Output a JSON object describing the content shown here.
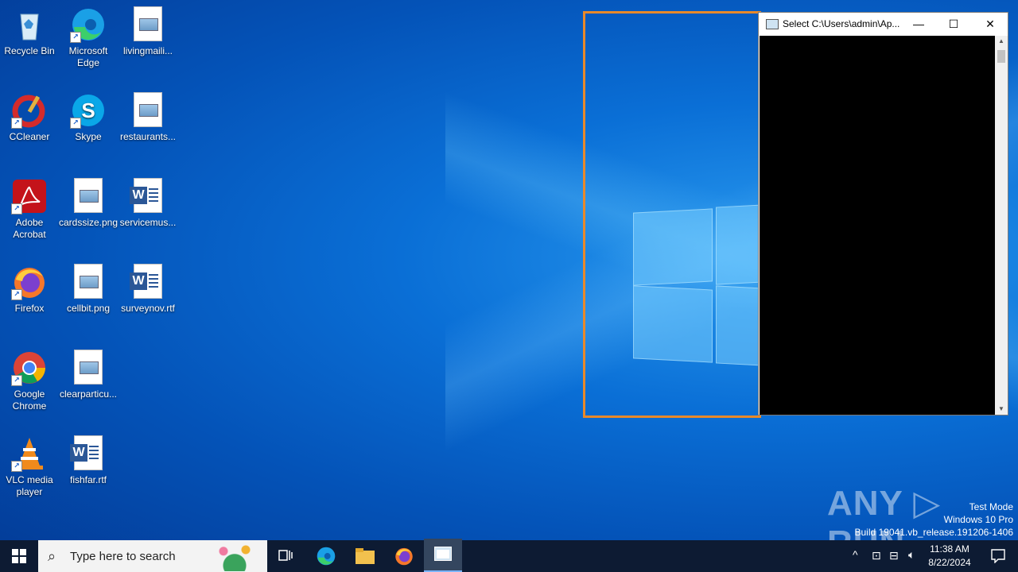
{
  "desktop": {
    "icons": [
      {
        "label": "Recycle Bin"
      },
      {
        "label": "Microsoft Edge"
      },
      {
        "label": "livingmaili..."
      },
      {
        "label": "CCleaner"
      },
      {
        "label": "Skype"
      },
      {
        "label": "restaurants..."
      },
      {
        "label": "Adobe Acrobat"
      },
      {
        "label": "cardssize.png"
      },
      {
        "label": "servicemus..."
      },
      {
        "label": "Firefox"
      },
      {
        "label": "cellbit.png"
      },
      {
        "label": "surveynov.rtf"
      },
      {
        "label": "Google Chrome"
      },
      {
        "label": "clearparticu..."
      },
      {
        "label": "VLC media player"
      },
      {
        "label": "fishfar.rtf"
      }
    ]
  },
  "console_window": {
    "title": "Select C:\\Users\\admin\\Ap...",
    "minimize": "—",
    "maximize": "☐",
    "close": "✕"
  },
  "watermark": {
    "brand": "ANY ▷ RUN",
    "line1": "Test Mode",
    "line2": "Windows 10 Pro",
    "line3": "Build 19041.vb_release.191206-1406"
  },
  "taskbar": {
    "search_placeholder": "Type here to search",
    "time": "11:38 AM",
    "date": "8/22/2024"
  },
  "colors": {
    "selection": "#e8892a",
    "taskbar": "#0d1b33"
  }
}
